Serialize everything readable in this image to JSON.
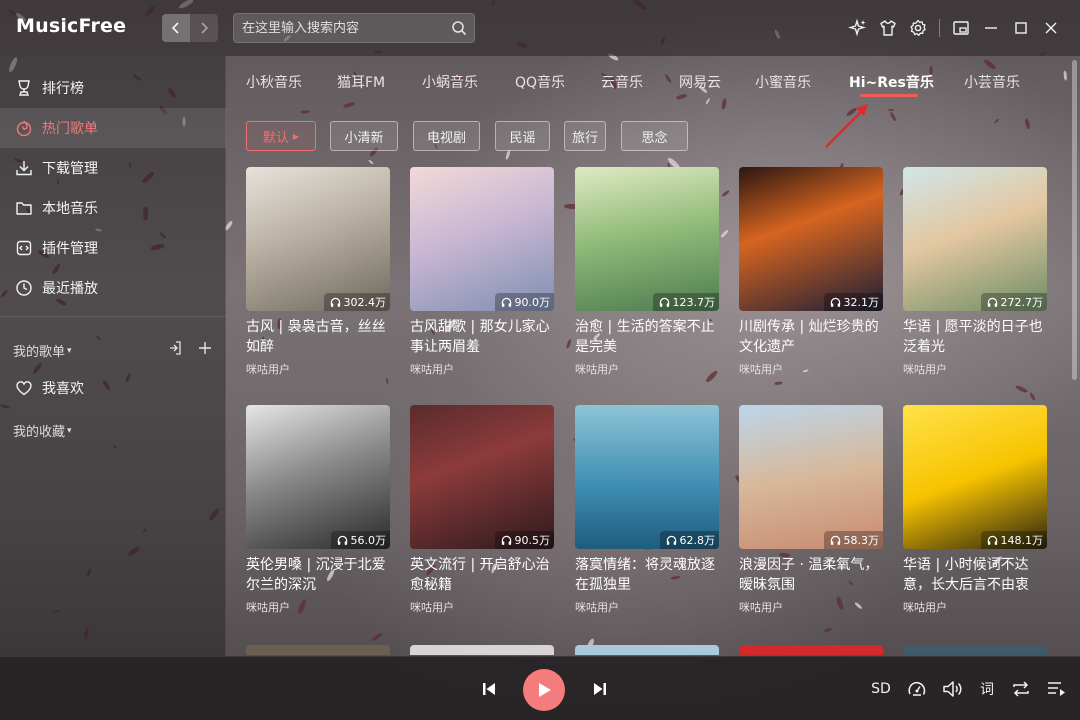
{
  "app": {
    "title": "MusicFree"
  },
  "search": {
    "placeholder": "在这里输入搜索内容"
  },
  "sidebar": {
    "items": [
      {
        "label": "排行榜",
        "icon": "trophy-icon"
      },
      {
        "label": "热门歌单",
        "icon": "hot-playlist-icon",
        "active": true
      },
      {
        "label": "下载管理",
        "icon": "download-icon"
      },
      {
        "label": "本地音乐",
        "icon": "folder-icon"
      },
      {
        "label": "插件管理",
        "icon": "plugin-icon"
      },
      {
        "label": "最近播放",
        "icon": "clock-icon"
      }
    ],
    "my_playlists_label": "我的歌单",
    "favorites_label": "我喜欢",
    "my_collection_label": "我的收藏"
  },
  "tabs": [
    {
      "label": "小秋音乐"
    },
    {
      "label": "猫耳FM"
    },
    {
      "label": "小蜗音乐"
    },
    {
      "label": "QQ音乐"
    },
    {
      "label": "云音乐"
    },
    {
      "label": "网易云"
    },
    {
      "label": "小蜜音乐"
    },
    {
      "label": "Hi~Res音乐",
      "active": true
    },
    {
      "label": "小芸音乐"
    }
  ],
  "tags": [
    {
      "label": "默认",
      "active": true
    },
    {
      "label": "小清新"
    },
    {
      "label": "电视剧"
    },
    {
      "label": "民谣"
    },
    {
      "label": "旅行"
    },
    {
      "label": "思念"
    }
  ],
  "playlists": [
    {
      "title": "古风 | 袅袅古音，丝丝如醉",
      "author": "咪咕用户",
      "plays": "302.4万"
    },
    {
      "title": "古风甜歌 | 那女儿家心事让两眉羞",
      "author": "咪咕用户",
      "plays": "90.0万"
    },
    {
      "title": "治愈 | 生活的答案不止是完美",
      "author": "咪咕用户",
      "plays": "123.7万"
    },
    {
      "title": "川剧传承 | 灿烂珍贵的文化遗产",
      "author": "咪咕用户",
      "plays": "32.1万"
    },
    {
      "title": "华语 | 愿平淡的日子也泛着光",
      "author": "咪咕用户",
      "plays": "272.7万"
    },
    {
      "title": "英伦男嗓 | 沉浸于北爱尔兰的深沉",
      "author": "咪咕用户",
      "plays": "56.0万"
    },
    {
      "title": "英文流行 | 开启舒心治愈秘籍",
      "author": "咪咕用户",
      "plays": "90.5万"
    },
    {
      "title": "落寞情绪：将灵魂放逐在孤独里",
      "author": "咪咕用户",
      "plays": "62.8万"
    },
    {
      "title": "浪漫因子 · 温柔氧气，暧昧氛围",
      "author": "咪咕用户",
      "plays": "58.3万"
    },
    {
      "title": "华语 | 小时候词不达意，长大后言不由衷",
      "author": "咪咕用户",
      "plays": "148.1万"
    }
  ],
  "player": {
    "quality_label": "SD",
    "lyrics_label": "词"
  },
  "colors": {
    "accent": "#f47c7c",
    "active_text": "#f07979",
    "tab_underline": "#f05b5b"
  }
}
